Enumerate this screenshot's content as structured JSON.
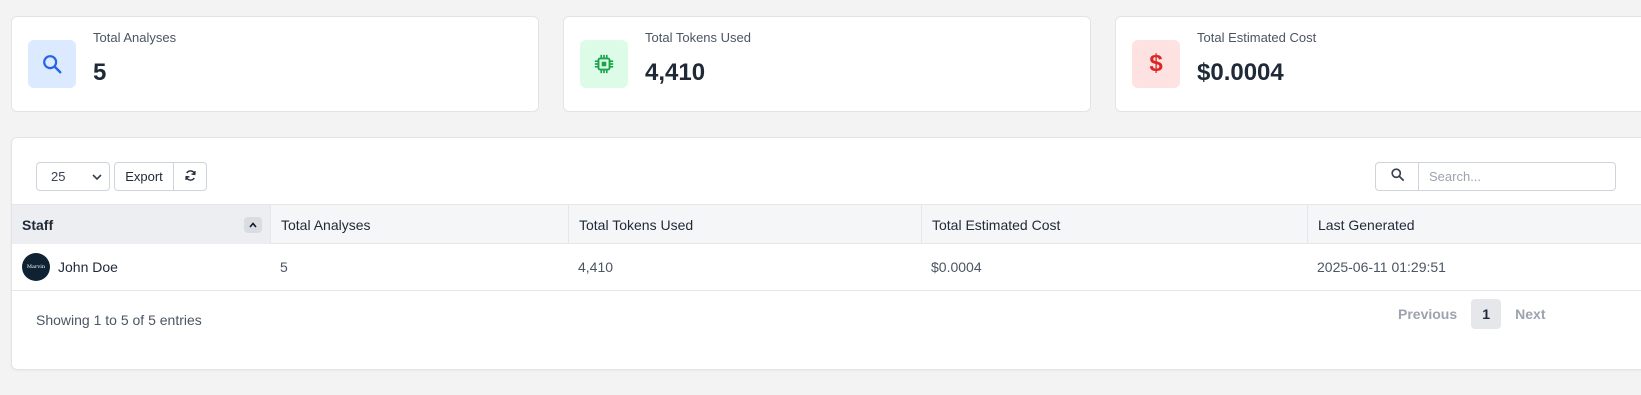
{
  "stats": [
    {
      "label": "Total Analyses",
      "value": "5",
      "icon": "search-icon",
      "color": "#2563eb"
    },
    {
      "label": "Total Tokens Used",
      "value": "4,410",
      "icon": "chip-icon",
      "color": "#16a34a"
    },
    {
      "label": "Total Estimated Cost",
      "value": "$0.0004",
      "icon": "dollar-icon",
      "color": "#dc2626"
    }
  ],
  "toolbar": {
    "page_length": "25",
    "export_label": "Export",
    "refresh_icon": "refresh-icon",
    "search_placeholder": "Search..."
  },
  "table": {
    "columns": [
      "Staff",
      "Total Analyses",
      "Total Tokens Used",
      "Total Estimated Cost",
      "Last Generated"
    ],
    "rows": [
      {
        "staff": "John Doe",
        "avatar_text": "Marvin",
        "analyses": "5",
        "tokens": "4,410",
        "cost": "$0.0004",
        "last_generated": "2025-06-11 01:29:51"
      }
    ]
  },
  "footer": {
    "info": "Showing 1 to 5 of 5 entries",
    "previous": "Previous",
    "current_page": "1",
    "next": "Next"
  }
}
